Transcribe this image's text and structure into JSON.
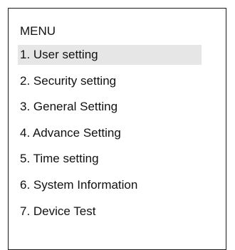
{
  "menu": {
    "title": "MENU",
    "selected_index": 0,
    "items": [
      {
        "label": "1. User setting"
      },
      {
        "label": "2. Security setting"
      },
      {
        "label": "3. General Setting"
      },
      {
        "label": "4. Advance Setting"
      },
      {
        "label": "5. Time setting"
      },
      {
        "label": "6. System Information"
      },
      {
        "label": "7. Device Test"
      }
    ]
  },
  "colors": {
    "highlight": "#e6e6e6",
    "text": "#111111",
    "border": "#1a1a1a"
  }
}
